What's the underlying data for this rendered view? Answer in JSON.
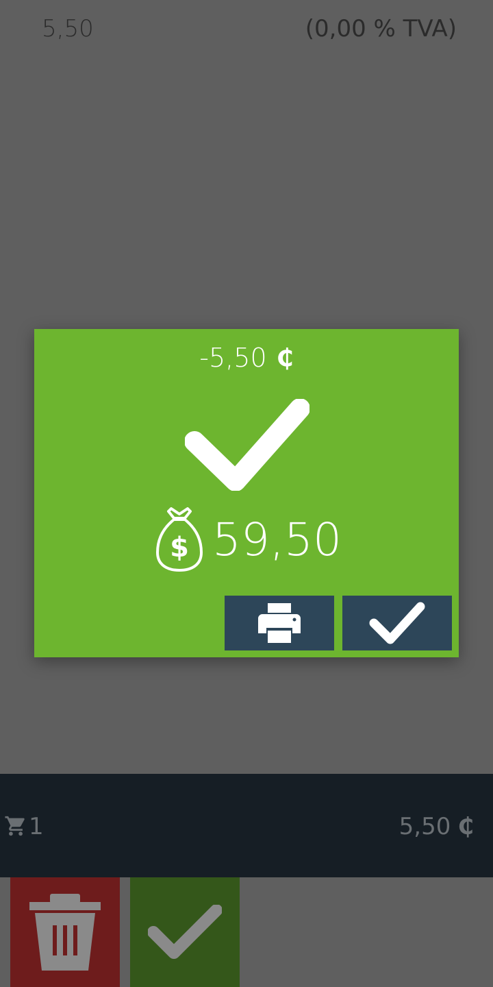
{
  "background": {
    "item_price": "5,50",
    "item_vat": "(0,00 % TVA)",
    "cart": {
      "count": "1",
      "total": "5,50",
      "currency_symbol": "₵"
    },
    "actions": {
      "delete_icon": "trash-icon",
      "validate_icon": "check-icon"
    }
  },
  "modal": {
    "amount": "-5,50",
    "currency_symbol": "₵",
    "status_icon": "check-icon",
    "balance_icon": "money-bag-icon",
    "balance": "59,50",
    "buttons": {
      "print_icon": "printer-icon",
      "confirm_icon": "check-icon"
    }
  },
  "colors": {
    "overlay": "#5f5f5f",
    "modal_green": "#6db52f",
    "button_navy": "#2d4659",
    "cart_bar": "#161e25",
    "delete_red": "#6e1c1c",
    "validate_green": "#34571a"
  }
}
